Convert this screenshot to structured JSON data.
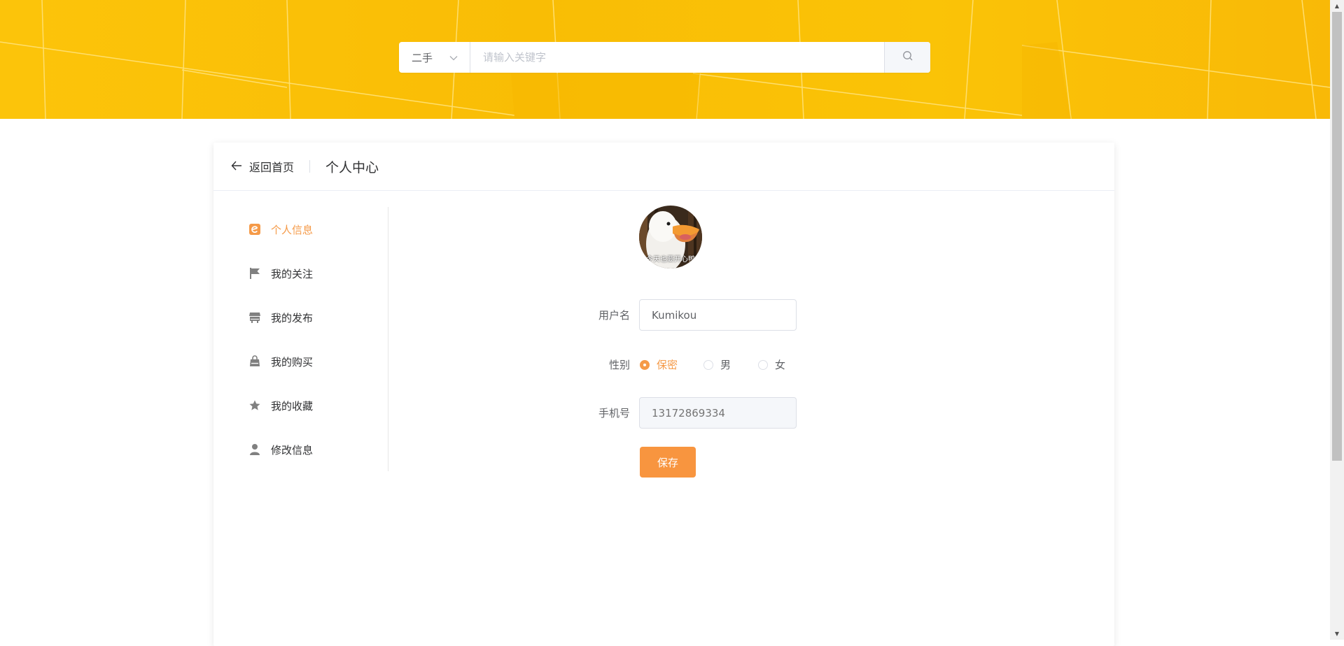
{
  "search": {
    "category": "二手",
    "placeholder": "请输入关键字"
  },
  "header": {
    "back_label": "返回首页",
    "title": "个人中心"
  },
  "sidebar": {
    "items": [
      {
        "label": "个人信息",
        "icon": "profile-icon",
        "active": true
      },
      {
        "label": "我的关注",
        "icon": "flag-icon",
        "active": false
      },
      {
        "label": "我的发布",
        "icon": "shop-icon",
        "active": false
      },
      {
        "label": "我的购买",
        "icon": "bag-icon",
        "active": false
      },
      {
        "label": "我的收藏",
        "icon": "star-icon",
        "active": false
      },
      {
        "label": "修改信息",
        "icon": "user-icon",
        "active": false
      }
    ]
  },
  "profile": {
    "avatar_caption": "今天也要开心鸭",
    "username_label": "用户名",
    "username_value": "Kumikou",
    "gender_label": "性别",
    "gender_options": [
      "保密",
      "男",
      "女"
    ],
    "gender_selected": "保密",
    "phone_label": "手机号",
    "phone_placeholder": "13172869334",
    "save_label": "保存"
  },
  "colors": {
    "accent": "#f8953f",
    "banner": "#fac307"
  }
}
